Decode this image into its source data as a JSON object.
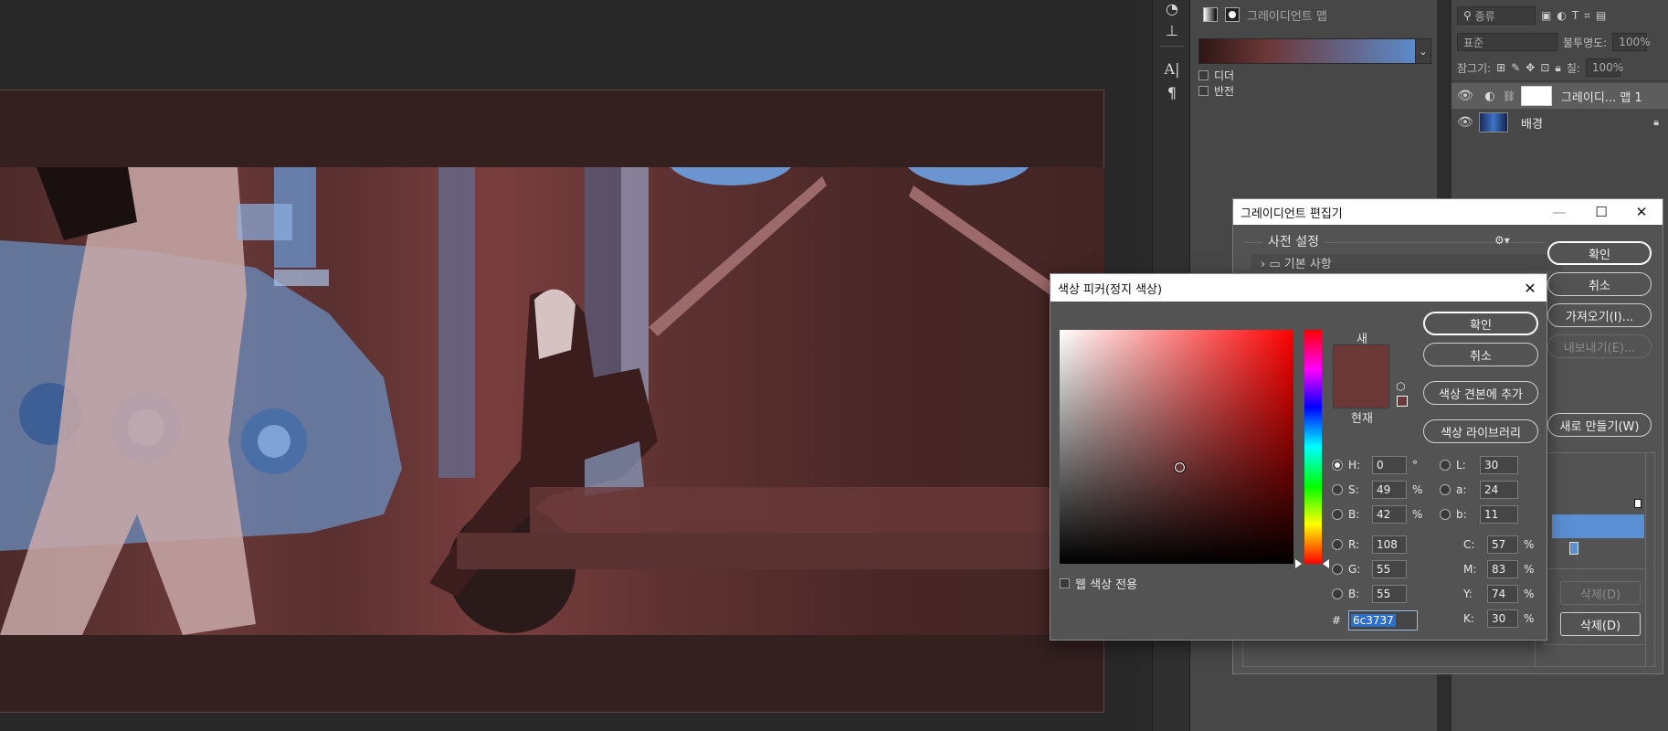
{
  "properties": {
    "title": "그레이디언트 맵",
    "options": [
      {
        "label": "디더",
        "checked": false
      },
      {
        "label": "반전",
        "checked": false
      }
    ]
  },
  "layers": {
    "filter_kind": "종류",
    "blend_mode": "표준",
    "opacity_label": "불투명도:",
    "opacity_value": "100%",
    "lock_label": "잠그기:",
    "fill_label": "칠:",
    "fill_value": "100%",
    "items": [
      {
        "name": "그레이디... 맵 1",
        "visible": true
      },
      {
        "name": "배경",
        "visible": true,
        "locked": true
      }
    ]
  },
  "gradient_editor": {
    "title": "그레이디언트 편집기",
    "presets_label": "사전 설정",
    "folder_label": "기본 사항",
    "buttons": {
      "ok": "확인",
      "cancel": "취소",
      "import": "가져오기(I)...",
      "export": "내보내기(E)...",
      "new": "새로 만들기(W)",
      "delete_disabled": "삭제(D)",
      "delete": "삭제(D)"
    },
    "window_controls": {
      "minimize": "—",
      "maximize": "☐",
      "close": "✕"
    }
  },
  "color_picker": {
    "title": "색상 피커(정지 색상)",
    "new_label": "새",
    "current_label": "현재",
    "buttons": {
      "ok": "확인",
      "cancel": "취소",
      "add_swatch": "색상 견본에 추가",
      "color_library": "색상 라이브러리"
    },
    "websafe_label": "웹 색상 전용",
    "hsb": [
      {
        "label": "H:",
        "value": "0",
        "unit": "°",
        "selected": true
      },
      {
        "label": "S:",
        "value": "49",
        "unit": "%"
      },
      {
        "label": "B:",
        "value": "42",
        "unit": "%"
      }
    ],
    "rgb": [
      {
        "label": "R:",
        "value": "108"
      },
      {
        "label": "G:",
        "value": "55"
      },
      {
        "label": "B:",
        "value": "55"
      }
    ],
    "lab": [
      {
        "label": "L:",
        "value": "30"
      },
      {
        "label": "a:",
        "value": "24"
      },
      {
        "label": "b:",
        "value": "11"
      }
    ],
    "cmyk": [
      {
        "label": "C:",
        "value": "57",
        "unit": "%"
      },
      {
        "label": "M:",
        "value": "83",
        "unit": "%"
      },
      {
        "label": "Y:",
        "value": "74",
        "unit": "%"
      },
      {
        "label": "K:",
        "value": "30",
        "unit": "%"
      }
    ],
    "hex_label": "#",
    "hex_value": "6c3737"
  },
  "colors": {
    "selected_color": "#6c3737",
    "gradient_end": "#5b8fd3",
    "selection_blue": "#2d6ec9"
  }
}
